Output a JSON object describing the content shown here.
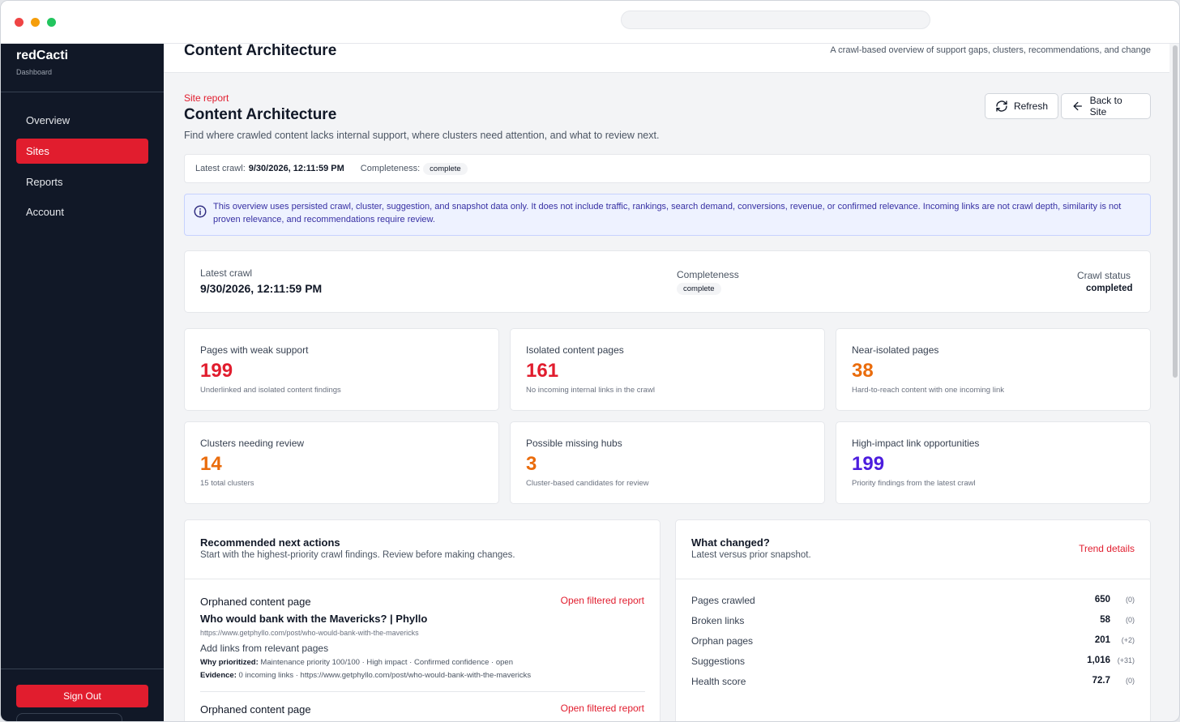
{
  "sidebar": {
    "brand": "redCacti",
    "brand_sub": "Dashboard",
    "items": [
      {
        "label": "Overview"
      },
      {
        "label": "Sites"
      },
      {
        "label": "Reports"
      },
      {
        "label": "Account"
      }
    ],
    "sign_out": "Sign Out"
  },
  "header": {
    "title": "Content Architecture",
    "description": "A crawl-based overview of support gaps, clusters, recommendations, and change"
  },
  "page": {
    "eyebrow": "Site report",
    "title": "Content Architecture",
    "description": "Find where crawled content lacks internal support, where clusters need attention, and what to review next.",
    "refresh_label": "Refresh",
    "back_label": "Back to Site"
  },
  "crawl_bar": {
    "latest_label": "Latest crawl:",
    "latest_value": "9/30/2026, 12:11:59 PM",
    "completeness_label": "Completeness:",
    "completeness_value": "complete"
  },
  "notice": {
    "text": "This overview uses persisted crawl, cluster, suggestion, and snapshot data only. It does not include traffic, rankings, search demand, conversions, revenue, or confirmed relevance. Incoming links are not crawl depth, similarity is not proven relevance, and recommendations require review."
  },
  "summary": {
    "latest_label": "Latest crawl",
    "latest_value": "9/30/2026, 12:11:59 PM",
    "completeness_label": "Completeness",
    "completeness_value": "complete",
    "status_label": "Crawl status",
    "status_value": "completed"
  },
  "metrics": [
    {
      "label": "Pages with weak support",
      "value": "199",
      "sub": "Underlinked and isolated content findings",
      "color": "#e11d2e"
    },
    {
      "label": "Isolated content pages",
      "value": "161",
      "sub": "No incoming internal links in the crawl",
      "color": "#e11d2e"
    },
    {
      "label": "Near-isolated pages",
      "value": "38",
      "sub": "Hard-to-reach content with one incoming link",
      "color": "#ea6c0c"
    },
    {
      "label": "Clusters needing review",
      "value": "14",
      "sub": "15 total clusters",
      "color": "#ea6c0c"
    },
    {
      "label": "Possible missing hubs",
      "value": "3",
      "sub": "Cluster-based candidates for review",
      "color": "#ea6c0c"
    },
    {
      "label": "High-impact link opportunities",
      "value": "199",
      "sub": "Priority findings from the latest crawl",
      "color": "#4c1dde"
    }
  ],
  "actions": {
    "title": "Recommended next actions",
    "subtitle": "Start with the highest-priority crawl findings. Review before making changes.",
    "items": [
      {
        "type": "Orphaned content page",
        "link": "Open filtered report",
        "title": "Who would bank with the Mavericks? | Phyllo",
        "url": "https://www.getphyllo.com/post/who-would-bank-with-the-mavericks",
        "action": "Add links from relevant pages",
        "why_label": "Why prioritized:",
        "why": "Maintenance priority 100/100 · High impact · Confirmed confidence · open",
        "evidence_label": "Evidence:",
        "evidence": "0 incoming links · https://www.getphyllo.com/post/who-would-bank-with-the-mavericks"
      },
      {
        "type": "Orphaned content page",
        "link": "Open filtered report"
      }
    ]
  },
  "changes": {
    "title": "What changed?",
    "subtitle": "Latest versus prior snapshot.",
    "link": "Trend details",
    "rows": [
      {
        "label": "Pages crawled",
        "value": "650",
        "delta": "(0)"
      },
      {
        "label": "Broken links",
        "value": "58",
        "delta": "(0)"
      },
      {
        "label": "Orphan pages",
        "value": "201",
        "delta": "(+2)"
      },
      {
        "label": "Suggestions",
        "value": "1,016",
        "delta": "(+31)"
      },
      {
        "label": "Health score",
        "value": "72.7",
        "delta": "(0)"
      }
    ]
  }
}
